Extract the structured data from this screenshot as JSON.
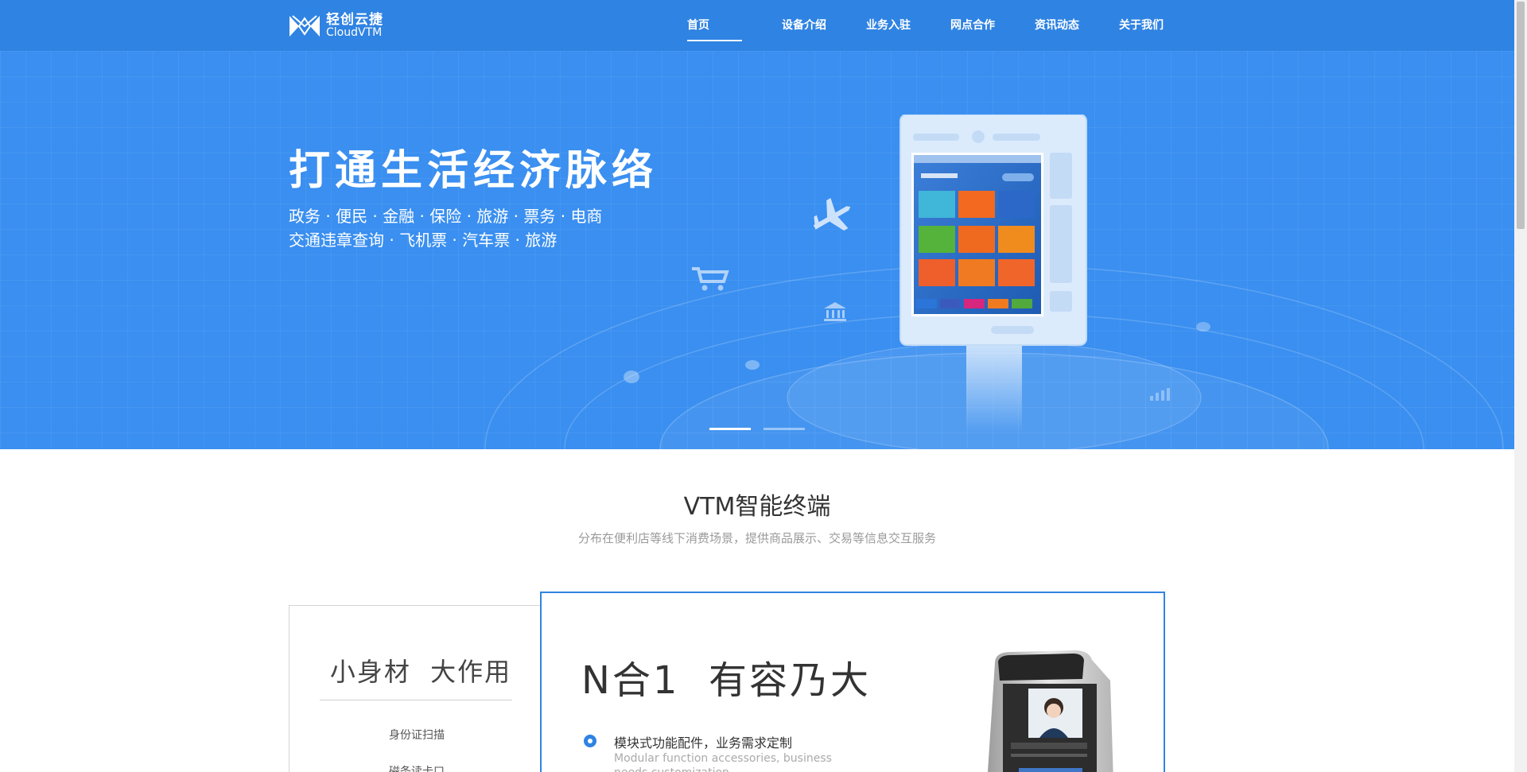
{
  "header": {
    "logo_cn": "轻创云捷",
    "logo_en": "CloudVTM",
    "nav": [
      "首页",
      "设备介绍",
      "业务入驻",
      "网点合作",
      "资讯动态",
      "关于我们"
    ],
    "active_index": 0
  },
  "hero": {
    "title": "打通生活经济脉络",
    "line1": "政务 · 便民 · 金融 · 保险 · 旅游 · 票务 · 电商",
    "line2": "交通违章查询 · 飞机票 · 汽车票 · 旅游",
    "slides": 2,
    "active_slide": 0
  },
  "section": {
    "title": "VTM智能终端",
    "subtitle": "分布在便利店等线下消费场景，提供商品展示、交易等信息交互服务"
  },
  "card_left": {
    "title": "小身材  大作用",
    "features": [
      "身份证扫描",
      "磁条读卡口"
    ]
  },
  "card_main": {
    "title": "N合1  有容乃大",
    "point_cn": "模块式功能配件，业务需求定制",
    "point_en": "Modular function accessories, business needs customization"
  },
  "colors": {
    "brand_blue": "#2f83e2",
    "hero_blue": "#3a8ff0"
  }
}
